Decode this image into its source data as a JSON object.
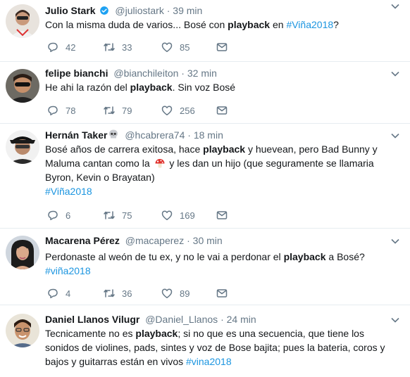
{
  "tweets": [
    {
      "name": "Julio Stark",
      "handle": "@juliostark",
      "dot": "·",
      "time": "39 min",
      "verified": true,
      "text_parts": [
        {
          "t": "Con la misma duda de varios... Bosé con "
        },
        {
          "t": "playback",
          "b": true
        },
        {
          "t": " en "
        },
        {
          "t": "#Viña2018",
          "h": true
        },
        {
          "t": "?"
        }
      ],
      "replies": "42",
      "retweets": "33",
      "likes": "85"
    },
    {
      "name": "felipe bianchi",
      "handle": "@bianchileiton",
      "dot": "·",
      "time": "32 min",
      "text_parts": [
        {
          "t": "He ahi la razón del "
        },
        {
          "t": "playback",
          "b": true
        },
        {
          "t": ". Sin voz Bosé"
        }
      ],
      "replies": "78",
      "retweets": "79",
      "likes": "256"
    },
    {
      "name": "Hernán Taker",
      "handle": "@hcabrera74",
      "dot": "·",
      "time": "18 min",
      "name_emoji": "skull",
      "text_parts": [
        {
          "t": "Bosé años de carrera exitosa, hace "
        },
        {
          "t": "playback",
          "b": true
        },
        {
          "t": " y huevean, pero Bad Bunny y Maluma cantan como la "
        },
        {
          "emoji": "mushroom"
        },
        {
          "t": " y  les dan un hijo (que seguramente se llamaria Byron, Kevin o Brayatan)"
        },
        {
          "br": true
        },
        {
          "t": "#Viña2018",
          "h": true
        }
      ],
      "replies": "6",
      "retweets": "75",
      "likes": "169"
    },
    {
      "name": "Macarena Pérez",
      "handle": "@macaperez",
      "dot": "·",
      "time": "30 min",
      "text_parts": [
        {
          "t": "Perdonaste al weón de tu ex, y no le vai a perdonar el "
        },
        {
          "t": "playback",
          "b": true
        },
        {
          "t": " a Bosé?"
        },
        {
          "br": true
        },
        {
          "t": "#viña2018",
          "h": true
        }
      ],
      "replies": "4",
      "retweets": "36",
      "likes": "89"
    },
    {
      "name": "Daniel Llanos Vilugr",
      "handle": "@Daniel_Llanos",
      "dot": "·",
      "time": "24 min",
      "text_parts": [
        {
          "t": "Tecnicamente no es "
        },
        {
          "t": "playback",
          "b": true
        },
        {
          "t": "; si no que es una secuencia, que tiene los sonidos de violines, pads, sintes y voz de Bose bajita; pues la bateria, coros y bajos y guitarras están en vivos "
        },
        {
          "t": "#vina2018",
          "h": true
        }
      ]
    }
  ],
  "colors": {
    "text": "#14171a",
    "muted": "#657786",
    "link": "#1b95e0",
    "divider": "#e6ecf0",
    "verified": "#1da1f2"
  },
  "icons": [
    "reply-icon",
    "retweet-icon",
    "like-icon",
    "direct-message-icon",
    "chevron-down-icon",
    "verified-badge-icon",
    "skull-emoji-icon",
    "mushroom-emoji-icon"
  ]
}
